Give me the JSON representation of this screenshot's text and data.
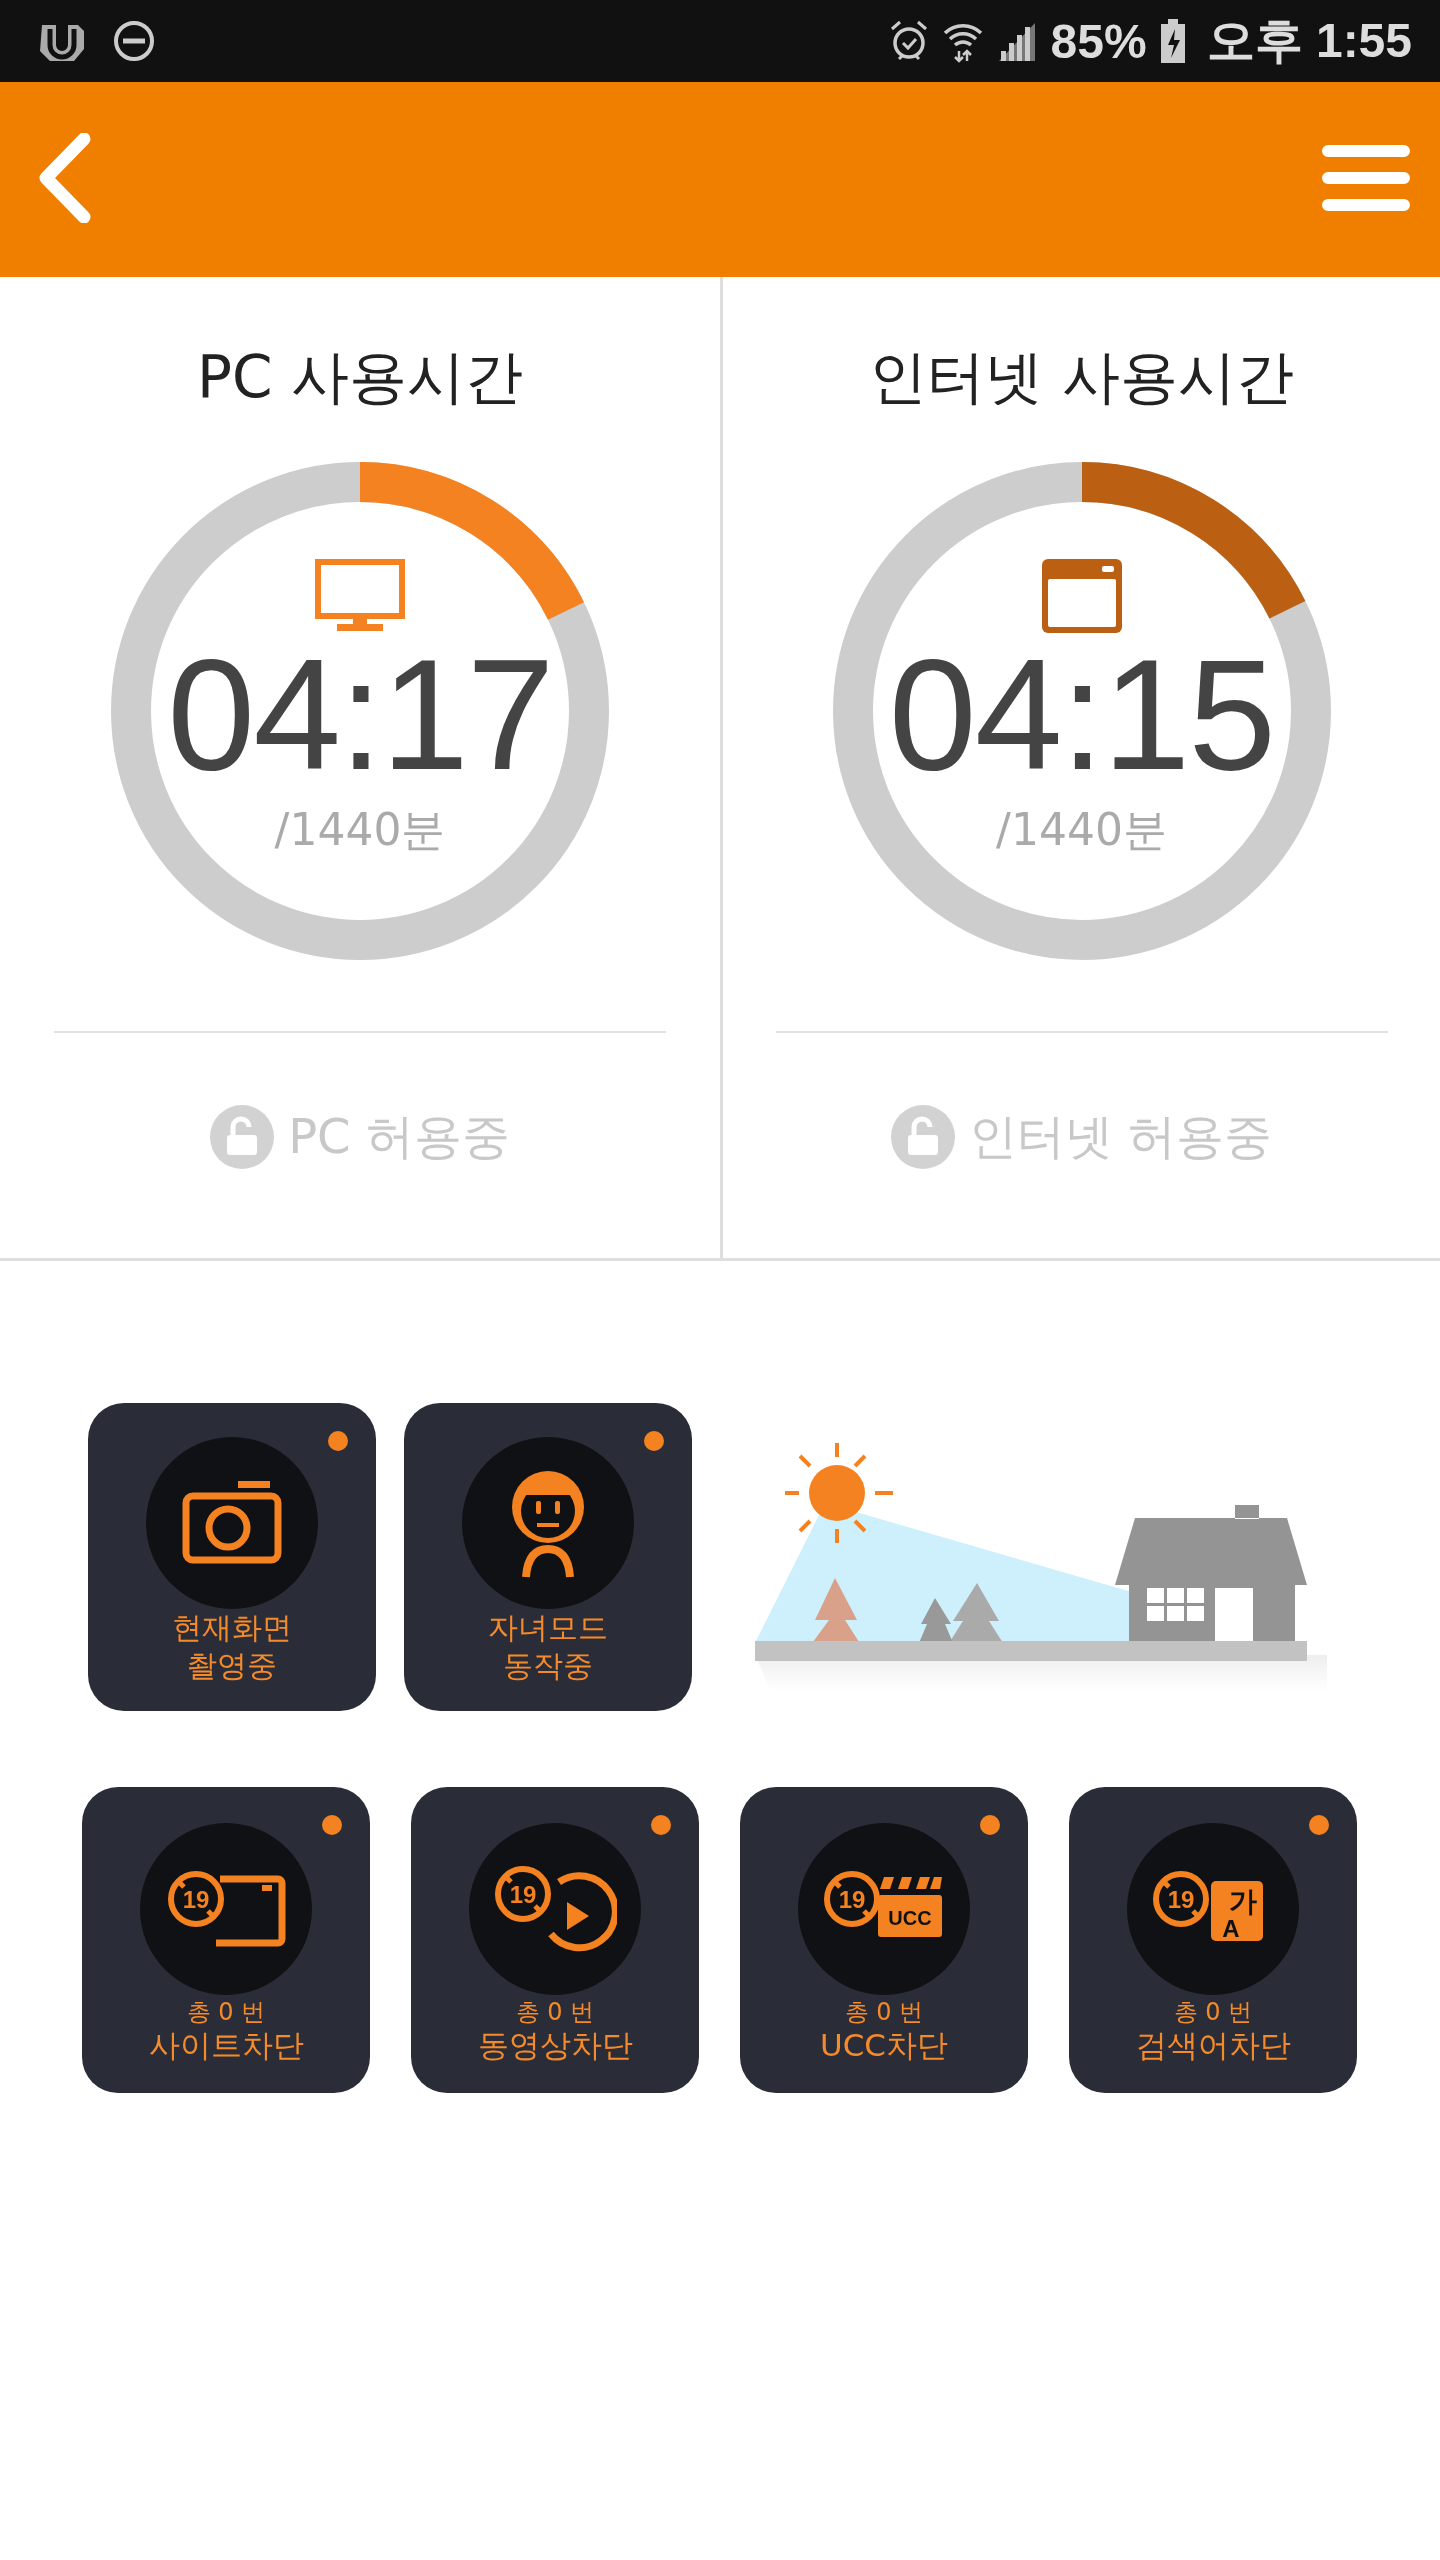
{
  "status_bar": {
    "battery": "85%",
    "time": "오후 1:55"
  },
  "usage_panels": [
    {
      "title": "PC 사용시간",
      "time": "04:17",
      "limit": "/1440분",
      "level": 0.178,
      "color": "#f58220",
      "status": "PC 허용중",
      "locked": false,
      "kind": "monitor"
    },
    {
      "title": "인터넷 사용시간",
      "time": "04:15",
      "limit": "/1440분",
      "level": 0.177,
      "color": "#bb6012",
      "status": "인터넷 허용중",
      "locked": false,
      "kind": "browser"
    }
  ],
  "status_tiles": [
    {
      "label": "현재화면\n촬영중",
      "kind": "camera"
    },
    {
      "label": "자녀모드\n동작중",
      "kind": "child"
    }
  ],
  "block_tiles": [
    {
      "count": "총 0 번",
      "label": "사이트차단",
      "age_mark": "19",
      "kind": "site"
    },
    {
      "count": "총 0 번",
      "label": "동영상차단",
      "age_mark": "19",
      "kind": "video"
    },
    {
      "count": "총 0 번",
      "label": "UCC차단",
      "age_mark": "19",
      "kind": "ucc",
      "icon_text": "UCC"
    },
    {
      "count": "총 0 번",
      "label": "검색어차단",
      "age_mark": "19",
      "kind": "search",
      "icon_text": "가",
      "icon_text_2": "A"
    }
  ]
}
